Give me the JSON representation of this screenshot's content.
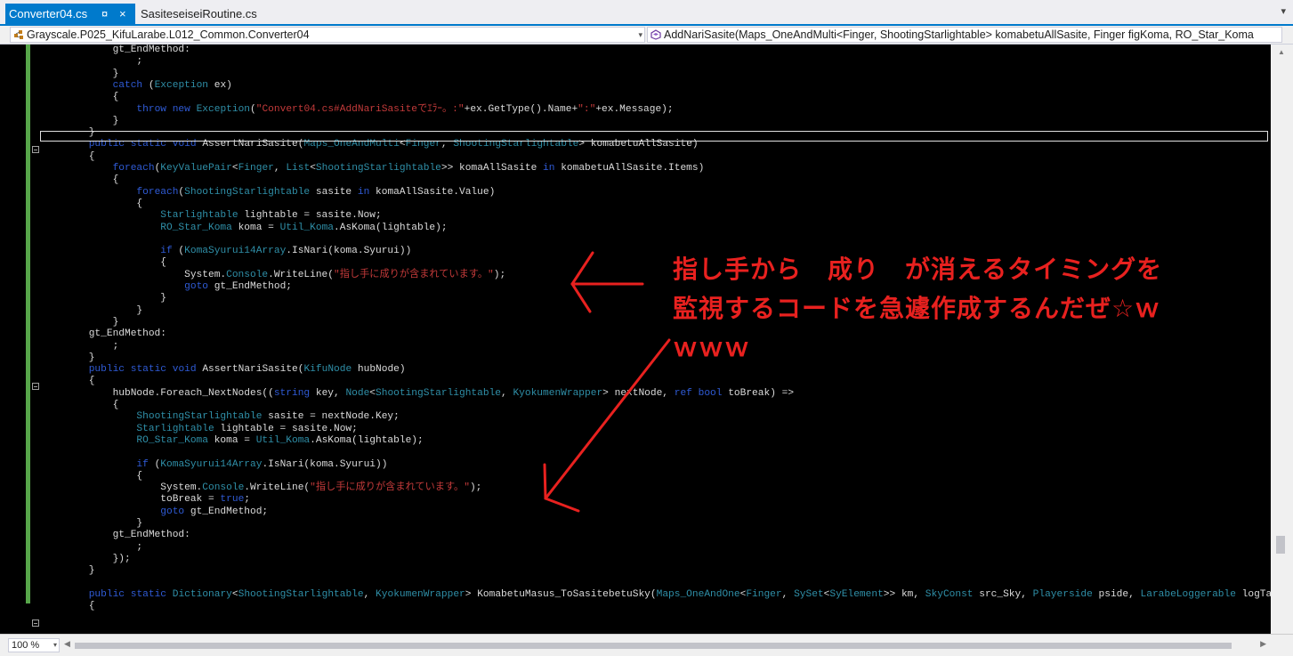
{
  "tabs": [
    {
      "label": "Converter04.cs",
      "pin": "¤",
      "close": "×"
    },
    {
      "label": "SasiteseiseiRoutine.cs"
    }
  ],
  "tab_dropdown": "▾",
  "nav": {
    "left": "Grayscale.P025_KifuLarabe.L012_Common.Converter04",
    "right": "AddNariSasite(Maps_OneAndMulti<Finger, ShootingStarlightable> komabetuAllSasite, Finger figKoma, RO_Star_Koma",
    "dropdown": "▾"
  },
  "code_lines": [
    [
      [
        "            gt_EndMethod:",
        ""
      ]
    ],
    [
      [
        "                ;",
        ""
      ]
    ],
    [
      [
        "            }",
        ""
      ]
    ],
    [
      [
        "            ",
        ""
      ],
      [
        "catch",
        "kw"
      ],
      [
        " (",
        ""
      ],
      [
        "Exception",
        "ty"
      ],
      [
        " ex)",
        ""
      ]
    ],
    [
      [
        "            {",
        ""
      ]
    ],
    [
      [
        "                ",
        ""
      ],
      [
        "throw",
        "kw"
      ],
      [
        " ",
        ""
      ],
      [
        "new",
        "kw"
      ],
      [
        " ",
        ""
      ],
      [
        "Exception",
        "ty"
      ],
      [
        "(",
        ""
      ],
      [
        "\"Convert04.cs#AddNariSasiteでｴﾗｰ。:\"",
        "st"
      ],
      [
        "+ex.GetType().Name+",
        ""
      ],
      [
        "\":\"",
        "st"
      ],
      [
        "+ex.Message);",
        ""
      ]
    ],
    [
      [
        "            }",
        ""
      ]
    ],
    [
      [
        "        }",
        ""
      ]
    ],
    [
      [
        "        ",
        ""
      ],
      [
        "public",
        "kw"
      ],
      [
        " ",
        ""
      ],
      [
        "static",
        "kw"
      ],
      [
        " ",
        ""
      ],
      [
        "void",
        "kw"
      ],
      [
        " AssertNariSasite(",
        ""
      ],
      [
        "Maps_OneAndMulti",
        "ty"
      ],
      [
        "<",
        ""
      ],
      [
        "Finger",
        "ty"
      ],
      [
        ", ",
        ""
      ],
      [
        "ShootingStarlightable",
        "ty"
      ],
      [
        "> komabetuAllSasite)",
        ""
      ]
    ],
    [
      [
        "        {",
        ""
      ]
    ],
    [
      [
        "            ",
        ""
      ],
      [
        "foreach",
        "kw"
      ],
      [
        "(",
        ""
      ],
      [
        "KeyValuePair",
        "ty"
      ],
      [
        "<",
        ""
      ],
      [
        "Finger",
        "ty"
      ],
      [
        ", ",
        ""
      ],
      [
        "List",
        "ty"
      ],
      [
        "<",
        ""
      ],
      [
        "ShootingStarlightable",
        "ty"
      ],
      [
        ">> komaAllSasite ",
        ""
      ],
      [
        "in",
        "kw"
      ],
      [
        " komabetuAllSasite.Items)",
        ""
      ]
    ],
    [
      [
        "            {",
        ""
      ]
    ],
    [
      [
        "                ",
        ""
      ],
      [
        "foreach",
        "kw"
      ],
      [
        "(",
        ""
      ],
      [
        "ShootingStarlightable",
        "ty"
      ],
      [
        " sasite ",
        ""
      ],
      [
        "in",
        "kw"
      ],
      [
        " komaAllSasite.Value)",
        ""
      ]
    ],
    [
      [
        "                {",
        ""
      ]
    ],
    [
      [
        "                    ",
        ""
      ],
      [
        "Starlightable",
        "ty"
      ],
      [
        " lightable = sasite.Now;",
        ""
      ]
    ],
    [
      [
        "                    ",
        ""
      ],
      [
        "RO_Star_Koma",
        "ty"
      ],
      [
        " koma = ",
        ""
      ],
      [
        "Util_Koma",
        "ty"
      ],
      [
        ".AsKoma(lightable);",
        ""
      ]
    ],
    [
      [
        "",
        ""
      ]
    ],
    [
      [
        "                    ",
        ""
      ],
      [
        "if",
        "kw"
      ],
      [
        " (",
        ""
      ],
      [
        "KomaSyurui14Array",
        "ty"
      ],
      [
        ".IsNari(koma.Syurui))",
        ""
      ]
    ],
    [
      [
        "                    {",
        ""
      ]
    ],
    [
      [
        "                        System.",
        ""
      ],
      [
        "Console",
        "ty"
      ],
      [
        ".WriteLine(",
        ""
      ],
      [
        "\"指し手に成りが含まれています。\"",
        "st"
      ],
      [
        ");",
        ""
      ]
    ],
    [
      [
        "                        ",
        ""
      ],
      [
        "goto",
        "kw"
      ],
      [
        " gt_EndMethod;",
        ""
      ]
    ],
    [
      [
        "                    }",
        ""
      ]
    ],
    [
      [
        "                }",
        ""
      ]
    ],
    [
      [
        "            }",
        ""
      ]
    ],
    [
      [
        "        gt_EndMethod:",
        ""
      ]
    ],
    [
      [
        "            ;",
        ""
      ]
    ],
    [
      [
        "        }",
        ""
      ]
    ],
    [
      [
        "        ",
        ""
      ],
      [
        "public",
        "kw"
      ],
      [
        " ",
        ""
      ],
      [
        "static",
        "kw"
      ],
      [
        " ",
        ""
      ],
      [
        "void",
        "kw"
      ],
      [
        " AssertNariSasite(",
        ""
      ],
      [
        "KifuNode",
        "ty"
      ],
      [
        " hubNode)",
        ""
      ]
    ],
    [
      [
        "        {",
        ""
      ]
    ],
    [
      [
        "            hubNode.Foreach_NextNodes((",
        ""
      ],
      [
        "string",
        "kw"
      ],
      [
        " key, ",
        ""
      ],
      [
        "Node",
        "ty"
      ],
      [
        "<",
        ""
      ],
      [
        "ShootingStarlightable",
        "ty"
      ],
      [
        ", ",
        ""
      ],
      [
        "KyokumenWrapper",
        "ty"
      ],
      [
        "> nextNode, ",
        ""
      ],
      [
        "ref",
        "kw"
      ],
      [
        " ",
        ""
      ],
      [
        "bool",
        "kw"
      ],
      [
        " toBreak) =>",
        ""
      ]
    ],
    [
      [
        "            {",
        ""
      ]
    ],
    [
      [
        "                ",
        ""
      ],
      [
        "ShootingStarlightable",
        "ty"
      ],
      [
        " sasite = nextNode.Key;",
        ""
      ]
    ],
    [
      [
        "                ",
        ""
      ],
      [
        "Starlightable",
        "ty"
      ],
      [
        " lightable = sasite.Now;",
        ""
      ]
    ],
    [
      [
        "                ",
        ""
      ],
      [
        "RO_Star_Koma",
        "ty"
      ],
      [
        " koma = ",
        ""
      ],
      [
        "Util_Koma",
        "ty"
      ],
      [
        ".AsKoma(lightable);",
        ""
      ]
    ],
    [
      [
        "",
        ""
      ]
    ],
    [
      [
        "                ",
        ""
      ],
      [
        "if",
        "kw"
      ],
      [
        " (",
        ""
      ],
      [
        "KomaSyurui14Array",
        "ty"
      ],
      [
        ".IsNari(koma.Syurui))",
        ""
      ]
    ],
    [
      [
        "                {",
        ""
      ]
    ],
    [
      [
        "                    System.",
        ""
      ],
      [
        "Console",
        "ty"
      ],
      [
        ".WriteLine(",
        ""
      ],
      [
        "\"指し手に成りが含まれています。\"",
        "st"
      ],
      [
        ");",
        ""
      ]
    ],
    [
      [
        "                    toBreak = ",
        ""
      ],
      [
        "true",
        "kw"
      ],
      [
        ";",
        ""
      ]
    ],
    [
      [
        "                    ",
        ""
      ],
      [
        "goto",
        "kw"
      ],
      [
        " gt_EndMethod;",
        ""
      ]
    ],
    [
      [
        "                }",
        ""
      ]
    ],
    [
      [
        "            gt_EndMethod:",
        ""
      ]
    ],
    [
      [
        "                ;",
        ""
      ]
    ],
    [
      [
        "            });",
        ""
      ]
    ],
    [
      [
        "        }",
        ""
      ]
    ],
    [
      [
        "",
        ""
      ]
    ],
    [
      [
        "        ",
        ""
      ],
      [
        "public",
        "kw"
      ],
      [
        " ",
        ""
      ],
      [
        "static",
        "kw"
      ],
      [
        " ",
        ""
      ],
      [
        "Dictionary",
        "ty"
      ],
      [
        "<",
        ""
      ],
      [
        "ShootingStarlightable",
        "ty"
      ],
      [
        ", ",
        ""
      ],
      [
        "KyokumenWrapper",
        "ty"
      ],
      [
        "> KomabetuMasus_ToSasitebetuSky(",
        ""
      ],
      [
        "Maps_OneAndOne",
        "ty"
      ],
      [
        "<",
        ""
      ],
      [
        "Finger",
        "ty"
      ],
      [
        ", ",
        ""
      ],
      [
        "SySet",
        "ty"
      ],
      [
        "<",
        ""
      ],
      [
        "SyElement",
        "ty"
      ],
      [
        ">> km, ",
        ""
      ],
      [
        "SkyConst",
        "ty"
      ],
      [
        " src_Sky, ",
        ""
      ],
      [
        "Playerside",
        "ty"
      ],
      [
        " pside, ",
        ""
      ],
      [
        "LarabeLoggerable",
        "ty"
      ],
      [
        " logTag)",
        ""
      ]
    ],
    [
      [
        "        {",
        ""
      ]
    ]
  ],
  "annotation": {
    "line1": "指し手から　成り　が消えるタイミングを",
    "line2": "監視するコードを急遽作成するんだぜ☆ｗ",
    "line3": "ｗｗｗ",
    "color": "#e8211f"
  },
  "status": {
    "zoom": "100 %",
    "dropdown": "▾"
  },
  "scroll": {
    "up": "▲",
    "left": "◀",
    "right": "▶"
  }
}
